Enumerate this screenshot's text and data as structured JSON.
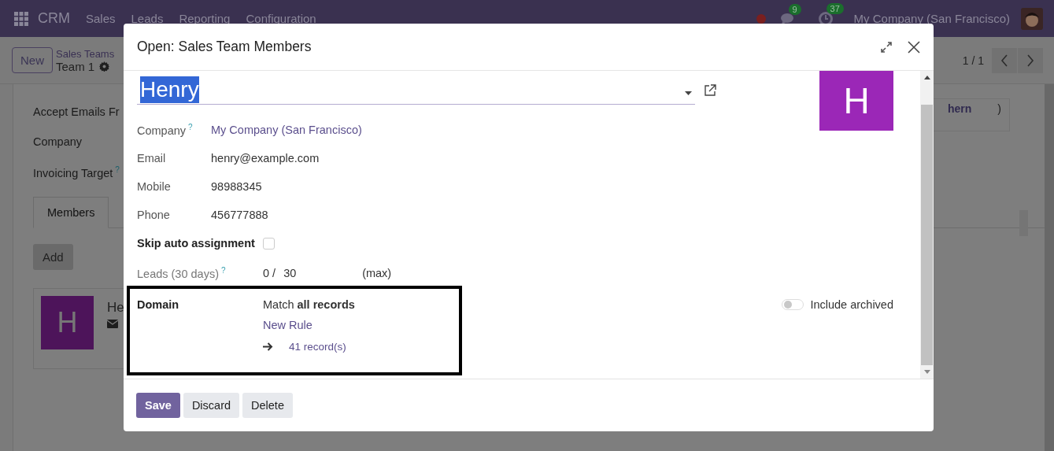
{
  "navbar": {
    "app_name": "CRM",
    "menu": [
      "Sales",
      "Leads",
      "Reporting",
      "Configuration"
    ],
    "messages_badge": "9",
    "activities_badge": "37",
    "company": "My Company (San Francisco)"
  },
  "control_panel": {
    "new_button": "New",
    "breadcrumb": "Sales Teams",
    "record": "Team 1",
    "pager": "1 / 1"
  },
  "form": {
    "fields": [
      {
        "label": "Accept Emails Fr"
      },
      {
        "label": "Company"
      },
      {
        "label": "Invoicing Target",
        "help": "?"
      }
    ],
    "tabs": [
      {
        "label": "Members",
        "selected": true
      }
    ],
    "add_button": "Add",
    "member_card": {
      "initial": "H",
      "name": "He"
    },
    "right_tag": {
      "text": "hern",
      "close": ")"
    }
  },
  "dialog": {
    "title": "Open: Sales Team Members",
    "name": "Henry",
    "name_selected": true,
    "avatar_initial": "H",
    "fields": [
      {
        "kind": "link",
        "label": "Company",
        "help": "?",
        "value": "My Company (San Francisco)"
      },
      {
        "kind": "text",
        "label": "Email",
        "value": "henry@example.com"
      },
      {
        "kind": "text",
        "label": "Mobile",
        "value": "98988345"
      },
      {
        "kind": "text",
        "label": "Phone",
        "value": "456777888"
      },
      {
        "kind": "checkbox",
        "label": "Skip auto assignment",
        "checked": false
      },
      {
        "kind": "leads",
        "label": "Leads (30 days)",
        "help": "?",
        "value": "0 /",
        "max": "30",
        "suffix": "(max)"
      }
    ],
    "domain": {
      "label": "Domain",
      "match": "Match **all records**",
      "new_rule": "New Rule",
      "count": "41 record(s)",
      "include_archived": false,
      "include_archived_label": "Include archived"
    },
    "buttons": [
      {
        "label": "Save",
        "kind": "primary"
      },
      {
        "label": "Discard",
        "kind": "secondary"
      },
      {
        "label": "Delete",
        "kind": "secondary"
      }
    ]
  }
}
